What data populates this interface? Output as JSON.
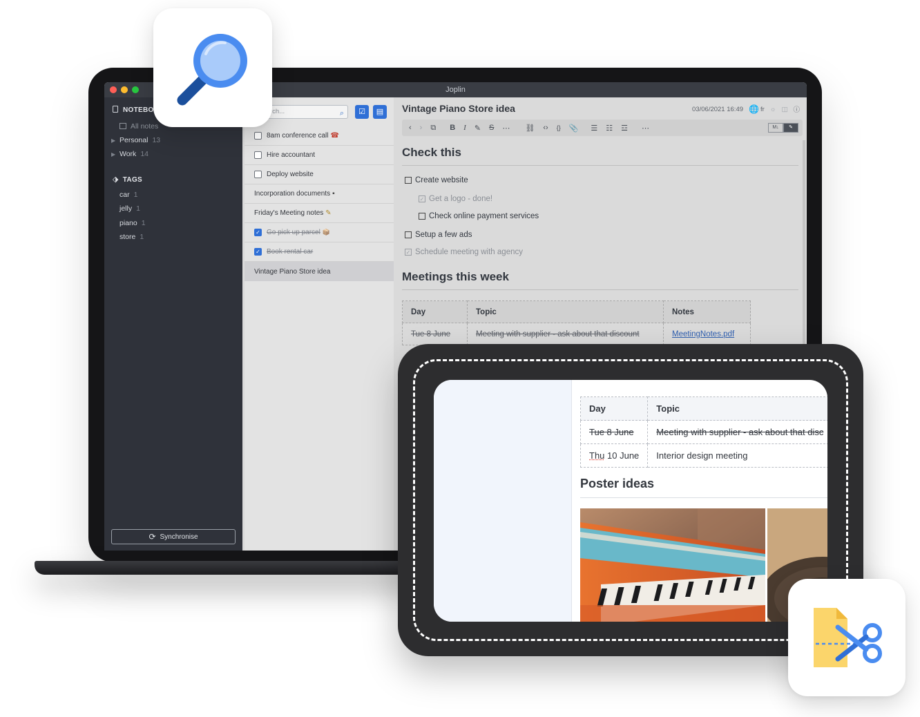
{
  "window": {
    "title": "Joplin"
  },
  "sidebar": {
    "notebooks_header": "NOTEBO",
    "all_notes": "All notes",
    "notebooks": [
      {
        "label": "Personal",
        "count": "13"
      },
      {
        "label": "Work",
        "count": "14"
      }
    ],
    "tags_header": "TAGS",
    "tags": [
      {
        "label": "car",
        "count": "1"
      },
      {
        "label": "jelly",
        "count": "1"
      },
      {
        "label": "piano",
        "count": "1"
      },
      {
        "label": "store",
        "count": "1"
      }
    ],
    "sync_label": "Synchronise"
  },
  "notelist": {
    "search_placeholder": "rch...",
    "items": [
      {
        "label": "8am conference call",
        "todo": true,
        "done": false,
        "emoji": "☎"
      },
      {
        "label": "Hire accountant",
        "todo": true,
        "done": false,
        "emoji": ""
      },
      {
        "label": "Deploy website",
        "todo": true,
        "done": false,
        "emoji": ""
      },
      {
        "label": "Incorporation documents",
        "todo": false,
        "done": false,
        "emoji": "▪"
      },
      {
        "label": "Friday's Meeting notes",
        "todo": false,
        "done": false,
        "emoji": "✎"
      },
      {
        "label": "Go pick up parcel",
        "todo": true,
        "done": true,
        "emoji": "📦"
      },
      {
        "label": "Book rental car",
        "todo": true,
        "done": true,
        "emoji": ""
      },
      {
        "label": "Vintage Piano Store idea",
        "todo": false,
        "done": false,
        "emoji": ""
      }
    ]
  },
  "editor": {
    "title": "Vintage Piano Store idea",
    "date": "03/06/2021 16:49",
    "lang": "fr",
    "heading1": "Check this",
    "tasks": [
      {
        "label": "Create website",
        "done": false,
        "indent": 0
      },
      {
        "label": "Get a logo - done!",
        "done": true,
        "indent": 1
      },
      {
        "label": "Check online payment services",
        "done": false,
        "indent": 1
      },
      {
        "label": "Setup a few ads",
        "done": false,
        "indent": 0
      },
      {
        "label": "Schedule meeting with agency",
        "done": true,
        "indent": 0
      }
    ],
    "heading2": "Meetings this week",
    "table_headers": [
      "Day",
      "Topic",
      "Notes"
    ],
    "table_rows": [
      {
        "day": "Tue 8 June",
        "topic": "Meeting with supplier - ask about that discount",
        "notes": "MeetingNotes.pdf"
      }
    ],
    "toolbar_toggle_md": "M↓"
  },
  "clipper": {
    "table_headers": [
      "Day",
      "Topic"
    ],
    "rows": [
      {
        "day": "Tue 8 June",
        "topic": "Meeting with supplier - ask about that disc",
        "struck": true
      },
      {
        "day_a": "Thu",
        "day_b": " 10 June",
        "topic": "Interior design meeting",
        "struck": false
      }
    ],
    "heading": "Poster ideas"
  },
  "icons": {
    "search_tile": "magnifier-icon",
    "clipper_tile": "web-clipper-scissors-icon"
  },
  "colors": {
    "accent": "#2f6fd6",
    "sidebar_bg": "#2f323a",
    "search_tile_blue": "#4a8cf0",
    "clip_tile_yellow": "#fbd56b"
  }
}
